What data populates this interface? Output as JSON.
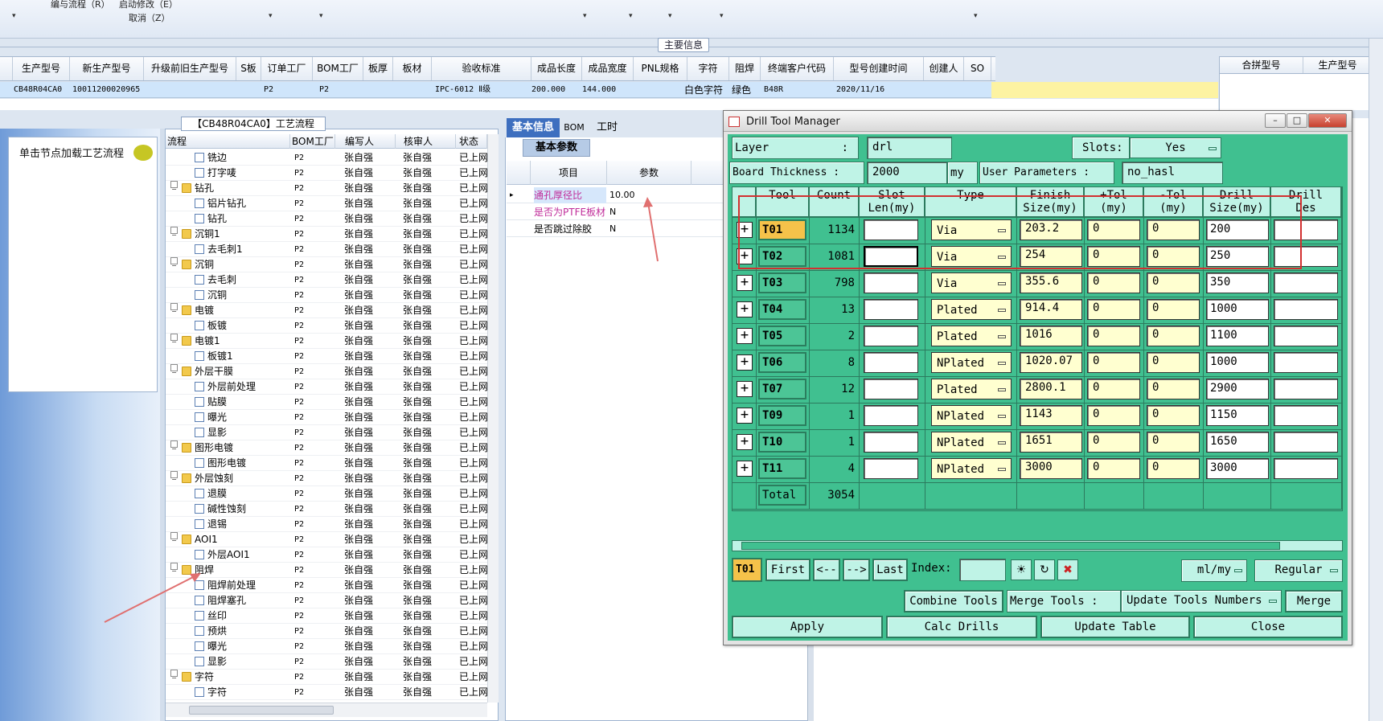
{
  "toolbar": {
    "item1": "编与流程（R）",
    "item2": "启动修改（E）",
    "item3": "取消（Z）"
  },
  "main_info": {
    "title": "主要信息",
    "columns": [
      "生产型号",
      "新生产型号",
      "升级前旧生产型号",
      "S板",
      "订单工厂",
      "BOM工厂",
      "板厚",
      "板材",
      "验收标准",
      "成品长度",
      "成品宽度",
      "PNL规格",
      "字符",
      "阻焊",
      "终端客户代码",
      "型号创建时间",
      "创建人",
      "SO"
    ],
    "row": [
      "CB48R04CA0",
      "10011200020965",
      "",
      "",
      "P2",
      "P2",
      "",
      "",
      "IPC-6012 Ⅱ级",
      "200.000",
      "144.000",
      "",
      "白色字符",
      "绿色",
      "B48R",
      "2020/11/16",
      "",
      ""
    ],
    "side_columns": [
      "合拼型号",
      "生产型号"
    ]
  },
  "left_panel": {
    "caption": "单击节点加载工艺流程"
  },
  "process_tree": {
    "title": "【CB48R04CA0】工艺流程",
    "columns": [
      "流程",
      "BOM工厂",
      "编写人",
      "核审人",
      "状态"
    ],
    "rows": [
      {
        "name": "铣边",
        "level": 2,
        "folder": false,
        "factory": "P2",
        "writer": "张自强",
        "reviewer": "张自强",
        "status": "已上网"
      },
      {
        "name": "打字唛",
        "level": 2,
        "folder": false,
        "factory": "P2",
        "writer": "张自强",
        "reviewer": "张自强",
        "status": "已上网"
      },
      {
        "name": "钻孔",
        "level": 1,
        "folder": true,
        "factory": "P2",
        "writer": "张自强",
        "reviewer": "张自强",
        "status": "已上网"
      },
      {
        "name": "铝片钻孔",
        "level": 2,
        "folder": false,
        "factory": "P2",
        "writer": "张自强",
        "reviewer": "张自强",
        "status": "已上网"
      },
      {
        "name": "钻孔",
        "level": 2,
        "folder": false,
        "factory": "P2",
        "writer": "张自强",
        "reviewer": "张自强",
        "status": "已上网"
      },
      {
        "name": "沉铜1",
        "level": 1,
        "folder": true,
        "factory": "P2",
        "writer": "张自强",
        "reviewer": "张自强",
        "status": "已上网"
      },
      {
        "name": "去毛刺1",
        "level": 2,
        "folder": false,
        "factory": "P2",
        "writer": "张自强",
        "reviewer": "张自强",
        "status": "已上网"
      },
      {
        "name": "沉铜",
        "level": 1,
        "folder": true,
        "factory": "P2",
        "writer": "张自强",
        "reviewer": "张自强",
        "status": "已上网"
      },
      {
        "name": "去毛刺",
        "level": 2,
        "folder": false,
        "factory": "P2",
        "writer": "张自强",
        "reviewer": "张自强",
        "status": "已上网"
      },
      {
        "name": "沉铜",
        "level": 2,
        "folder": false,
        "factory": "P2",
        "writer": "张自强",
        "reviewer": "张自强",
        "status": "已上网"
      },
      {
        "name": "电镀",
        "level": 1,
        "folder": true,
        "factory": "P2",
        "writer": "张自强",
        "reviewer": "张自强",
        "status": "已上网"
      },
      {
        "name": "板镀",
        "level": 2,
        "folder": false,
        "factory": "P2",
        "writer": "张自强",
        "reviewer": "张自强",
        "status": "已上网"
      },
      {
        "name": "电镀1",
        "level": 1,
        "folder": true,
        "factory": "P2",
        "writer": "张自强",
        "reviewer": "张自强",
        "status": "已上网"
      },
      {
        "name": "板镀1",
        "level": 2,
        "folder": false,
        "factory": "P2",
        "writer": "张自强",
        "reviewer": "张自强",
        "status": "已上网"
      },
      {
        "name": "外层干膜",
        "level": 1,
        "folder": true,
        "factory": "P2",
        "writer": "张自强",
        "reviewer": "张自强",
        "status": "已上网"
      },
      {
        "name": "外层前处理",
        "level": 2,
        "folder": false,
        "factory": "P2",
        "writer": "张自强",
        "reviewer": "张自强",
        "status": "已上网"
      },
      {
        "name": "贴膜",
        "level": 2,
        "folder": false,
        "factory": "P2",
        "writer": "张自强",
        "reviewer": "张自强",
        "status": "已上网"
      },
      {
        "name": "曝光",
        "level": 2,
        "folder": false,
        "factory": "P2",
        "writer": "张自强",
        "reviewer": "张自强",
        "status": "已上网"
      },
      {
        "name": "显影",
        "level": 2,
        "folder": false,
        "factory": "P2",
        "writer": "张自强",
        "reviewer": "张自强",
        "status": "已上网"
      },
      {
        "name": "图形电镀",
        "level": 1,
        "folder": true,
        "factory": "P2",
        "writer": "张自强",
        "reviewer": "张自强",
        "status": "已上网"
      },
      {
        "name": "图形电镀",
        "level": 2,
        "folder": false,
        "factory": "P2",
        "writer": "张自强",
        "reviewer": "张自强",
        "status": "已上网"
      },
      {
        "name": "外层蚀刻",
        "level": 1,
        "folder": true,
        "factory": "P2",
        "writer": "张自强",
        "reviewer": "张自强",
        "status": "已上网"
      },
      {
        "name": "退膜",
        "level": 2,
        "folder": false,
        "factory": "P2",
        "writer": "张自强",
        "reviewer": "张自强",
        "status": "已上网"
      },
      {
        "name": "碱性蚀刻",
        "level": 2,
        "folder": false,
        "factory": "P2",
        "writer": "张自强",
        "reviewer": "张自强",
        "status": "已上网"
      },
      {
        "name": "退锡",
        "level": 2,
        "folder": false,
        "factory": "P2",
        "writer": "张自强",
        "reviewer": "张自强",
        "status": "已上网"
      },
      {
        "name": "AOI1",
        "level": 1,
        "folder": true,
        "factory": "P2",
        "writer": "张自强",
        "reviewer": "张自强",
        "status": "已上网"
      },
      {
        "name": "外层AOI1",
        "level": 2,
        "folder": false,
        "factory": "P2",
        "writer": "张自强",
        "reviewer": "张自强",
        "status": "已上网"
      },
      {
        "name": "阻焊",
        "level": 1,
        "folder": true,
        "factory": "P2",
        "writer": "张自强",
        "reviewer": "张自强",
        "status": "已上网"
      },
      {
        "name": "阻焊前处理",
        "level": 2,
        "folder": false,
        "factory": "P2",
        "writer": "张自强",
        "reviewer": "张自强",
        "status": "已上网"
      },
      {
        "name": "阻焊塞孔",
        "level": 2,
        "folder": false,
        "factory": "P2",
        "writer": "张自强",
        "reviewer": "张自强",
        "status": "已上网"
      },
      {
        "name": "丝印",
        "level": 2,
        "folder": false,
        "factory": "P2",
        "writer": "张自强",
        "reviewer": "张自强",
        "status": "已上网"
      },
      {
        "name": "预烘",
        "level": 2,
        "folder": false,
        "factory": "P2",
        "writer": "张自强",
        "reviewer": "张自强",
        "status": "已上网"
      },
      {
        "name": "曝光",
        "level": 2,
        "folder": false,
        "factory": "P2",
        "writer": "张自强",
        "reviewer": "张自强",
        "status": "已上网"
      },
      {
        "name": "显影",
        "level": 2,
        "folder": false,
        "factory": "P2",
        "writer": "张自强",
        "reviewer": "张自强",
        "status": "已上网"
      },
      {
        "name": "字符",
        "level": 1,
        "folder": true,
        "factory": "P2",
        "writer": "张自强",
        "reviewer": "张自强",
        "status": "已上网"
      },
      {
        "name": "字符",
        "level": 2,
        "folder": false,
        "factory": "P2",
        "writer": "张自强",
        "reviewer": "张自强",
        "status": "已上网"
      }
    ]
  },
  "basic_info": {
    "tabs": [
      "基本信息",
      "BOM",
      "工时"
    ],
    "subtab": "基本参数",
    "columns": [
      "项目",
      "参数"
    ],
    "rows": [
      {
        "item": "通孔厚径比",
        "value": "10.00"
      },
      {
        "item": "是否为PTFE板材",
        "value": "N"
      },
      {
        "item": "是否跳过除胶",
        "value": "N"
      }
    ]
  },
  "drill_tool_manager": {
    "title": "Drill Tool Manager",
    "layer_label": "Layer",
    "layer_value": "drl",
    "slots_label": "Slots:",
    "slots_value": "Yes",
    "board_thickness_label": "Board Thickness :",
    "board_thickness_value": "2000",
    "board_thickness_unit": "my",
    "user_params_label": "User Parameters :",
    "user_params_value": "no_hasl",
    "columns": [
      {
        "line1": "Tool",
        "line2": ""
      },
      {
        "line1": "Count",
        "line2": ""
      },
      {
        "line1": "Slot",
        "line2": "Len(my)"
      },
      {
        "line1": "Type",
        "line2": ""
      },
      {
        "line1": "Finish",
        "line2": "Size(my)"
      },
      {
        "line1": "+Tol",
        "line2": "(my)"
      },
      {
        "line1": "-Tol",
        "line2": "(my)"
      },
      {
        "line1": "Drill",
        "line2": "Size(my)"
      },
      {
        "line1": "Drill",
        "line2": "Des"
      }
    ],
    "tools": [
      {
        "tool": "T01",
        "count": "1134",
        "type": "Via",
        "finish": "203.2",
        "ptol": "0",
        "ntol": "0",
        "drill": "200"
      },
      {
        "tool": "T02",
        "count": "1081",
        "type": "Via",
        "finish": "254",
        "ptol": "0",
        "ntol": "0",
        "drill": "250"
      },
      {
        "tool": "T03",
        "count": "798",
        "type": "Via",
        "finish": "355.6",
        "ptol": "0",
        "ntol": "0",
        "drill": "350"
      },
      {
        "tool": "T04",
        "count": "13",
        "type": "Plated",
        "finish": "914.4",
        "ptol": "0",
        "ntol": "0",
        "drill": "1000"
      },
      {
        "tool": "T05",
        "count": "2",
        "type": "Plated",
        "finish": "1016",
        "ptol": "0",
        "ntol": "0",
        "drill": "1100"
      },
      {
        "tool": "T06",
        "count": "8",
        "type": "NPlated",
        "finish": "1020.07",
        "ptol": "0",
        "ntol": "0",
        "drill": "1000"
      },
      {
        "tool": "T07",
        "count": "12",
        "type": "Plated",
        "finish": "2800.1",
        "ptol": "0",
        "ntol": "0",
        "drill": "2900"
      },
      {
        "tool": "T09",
        "count": "1",
        "type": "NPlated",
        "finish": "1143",
        "ptol": "0",
        "ntol": "0",
        "drill": "1150"
      },
      {
        "tool": "T10",
        "count": "1",
        "type": "NPlated",
        "finish": "1651",
        "ptol": "0",
        "ntol": "0",
        "drill": "1650"
      },
      {
        "tool": "T11",
        "count": "4",
        "type": "NPlated",
        "finish": "3000",
        "ptol": "0",
        "ntol": "0",
        "drill": "3000"
      }
    ],
    "total_label": "Total",
    "total_count": "3054",
    "nav": {
      "current": "T01",
      "first": "First",
      "prev": "<--",
      "next": "-->",
      "last": "Last",
      "index_label": "Index:",
      "units": "ml/my",
      "mode": "Regular"
    },
    "actions": {
      "combine": "Combine Tools",
      "merge_label": "Merge Tools :",
      "update_numbers": "Update Tools Numbers",
      "merge": "Merge",
      "apply": "Apply",
      "calc": "Calc Drills",
      "update_table": "Update Table",
      "close": "Close"
    }
  },
  "colors": {
    "green_bg": "#40c090",
    "green_light": "#bff3e6",
    "yellow_field": "#ffffd0",
    "selected_tool": "#f5c24a",
    "highlight_red": "#d23030",
    "tab_active": "#3e6fbf"
  }
}
